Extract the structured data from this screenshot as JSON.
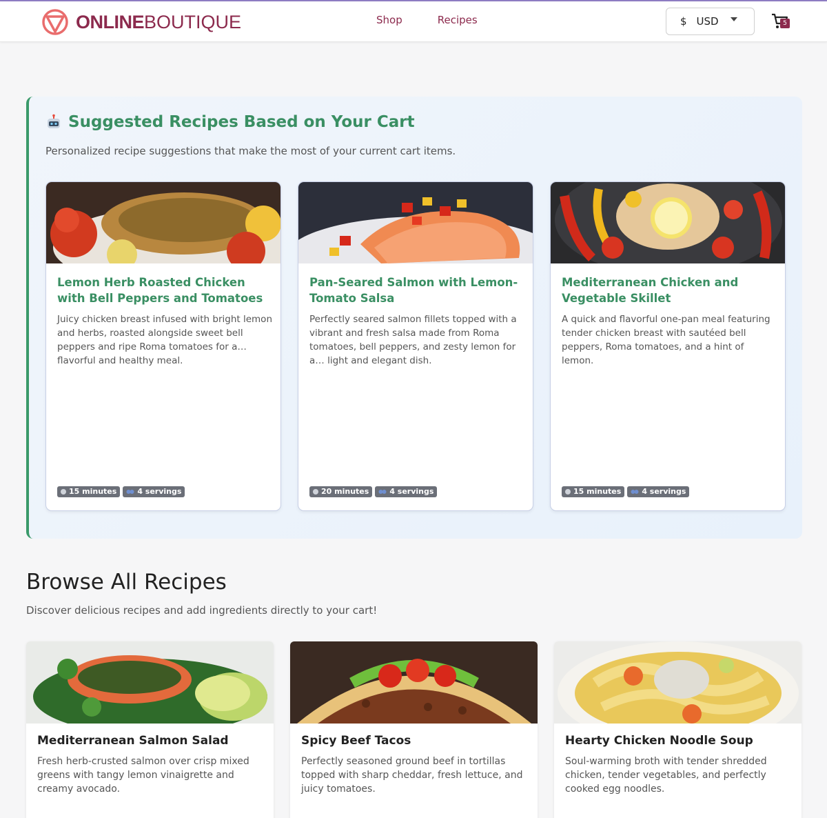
{
  "brand": {
    "name_bold": "ONLINE",
    "name_light": "BOUTIQUE"
  },
  "nav": {
    "shop": "Shop",
    "recipes": "Recipes"
  },
  "currency": {
    "symbol": "$",
    "code": "USD"
  },
  "cart": {
    "count": "5"
  },
  "suggested": {
    "title": "Suggested Recipes Based on Your Cart",
    "subtitle": "Personalized recipe suggestions that make the most of your current cart items.",
    "cards": [
      {
        "title": "Lemon Herb Roasted Chicken with Bell Peppers and Tomatoes",
        "description": "Juicy chicken breast infused with bright lemon and herbs, roasted alongside sweet bell peppers and ripe Roma tomatoes for a… flavorful and healthy meal.",
        "time": "15 minutes",
        "servings": "4 servings"
      },
      {
        "title": "Pan-Seared Salmon with Lemon-Tomato Salsa",
        "description": "Perfectly seared salmon fillets topped with a vibrant and fresh salsa made from Roma tomatoes, bell peppers, and zesty lemon for a… light and elegant dish.",
        "time": "20 minutes",
        "servings": "4 servings"
      },
      {
        "title": "Mediterranean Chicken and Vegetable Skillet",
        "description": "A quick and flavorful one-pan meal featuring tender chicken breast with sautéed bell peppers, Roma tomatoes, and a hint of lemon.",
        "time": "15 minutes",
        "servings": "4 servings"
      }
    ]
  },
  "browse": {
    "title": "Browse All Recipes",
    "subtitle": "Discover delicious recipes and add ingredients directly to your cart!",
    "cards": [
      {
        "title": "Mediterranean Salmon Salad",
        "description": "Fresh herb-crusted salmon over crisp mixed greens with tangy lemon vinaigrette and creamy avocado."
      },
      {
        "title": "Spicy Beef Tacos",
        "description": "Perfectly seasoned ground beef in tortillas topped with sharp cheddar, fresh lettuce, and juicy tomatoes."
      },
      {
        "title": "Hearty Chicken Noodle Soup",
        "description": "Soul-warming broth with tender shredded chicken, tender vegetables, and perfectly cooked egg noodles."
      }
    ]
  },
  "colors": {
    "brand": "#8c2a4d",
    "accent_green": "#3a8f63",
    "tag_bg": "#6b6f78"
  },
  "icons": [
    "brand-logo-icon",
    "cart-icon",
    "caret-down-icon",
    "robot-icon",
    "clock-icon",
    "people-icon"
  ]
}
